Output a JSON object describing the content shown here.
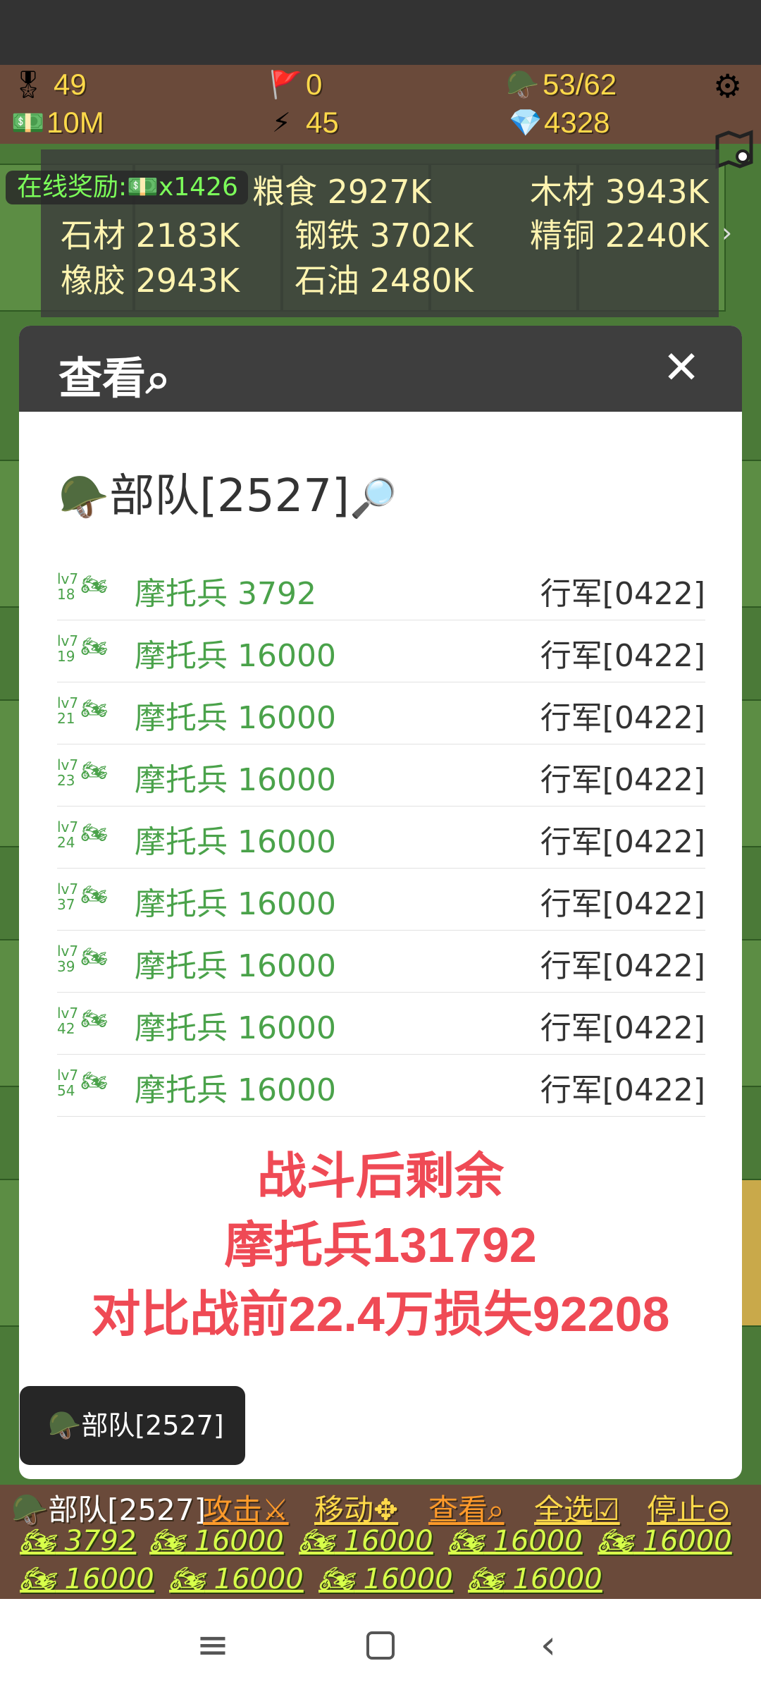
{
  "hud": {
    "medals": "49",
    "flags": "0",
    "troops": "53/62",
    "money": "10M",
    "energy": "45",
    "gems": "4328"
  },
  "reward": {
    "label": "在线奖励:💵x1426"
  },
  "resources": [
    {
      "label": "粮食 2927K"
    },
    {
      "label": "木材 3943K"
    },
    {
      "label": "石材 2183K"
    },
    {
      "label": "钢铁 3702K"
    },
    {
      "label": "精铜 2240K"
    },
    {
      "label": "橡胶 2943K"
    },
    {
      "label": "石油 2480K"
    }
  ],
  "modal": {
    "title": "查看⌕",
    "close": "✕",
    "troop_title": "部队[2527]",
    "units": [
      {
        "lvl_top": "lv7",
        "lvl_bottom": "18",
        "name": "摩托兵 3792",
        "status": "行军[0422]"
      },
      {
        "lvl_top": "lv7",
        "lvl_bottom": "19",
        "name": "摩托兵 16000",
        "status": "行军[0422]"
      },
      {
        "lvl_top": "lv7",
        "lvl_bottom": "21",
        "name": "摩托兵 16000",
        "status": "行军[0422]"
      },
      {
        "lvl_top": "lv7",
        "lvl_bottom": "23",
        "name": "摩托兵 16000",
        "status": "行军[0422]"
      },
      {
        "lvl_top": "lv7",
        "lvl_bottom": "24",
        "name": "摩托兵 16000",
        "status": "行军[0422]"
      },
      {
        "lvl_top": "lv7",
        "lvl_bottom": "37",
        "name": "摩托兵 16000",
        "status": "行军[0422]"
      },
      {
        "lvl_top": "lv7",
        "lvl_bottom": "39",
        "name": "摩托兵 16000",
        "status": "行军[0422]"
      },
      {
        "lvl_top": "lv7",
        "lvl_bottom": "42",
        "name": "摩托兵 16000",
        "status": "行军[0422]"
      },
      {
        "lvl_top": "lv7",
        "lvl_bottom": "54",
        "name": "摩托兵 16000",
        "status": "行军[0422]"
      }
    ],
    "note_lines": [
      "战斗后剩余",
      "摩托兵131792",
      "对比战前22.4万损失92208"
    ]
  },
  "toast": {
    "label": "部队[2527]"
  },
  "action_bar": {
    "troop_label": "部队[2527]",
    "attack": "攻击⚔",
    "move": "移动✥",
    "view": "查看⌕",
    "select_all": "全选☑",
    "stop": "停止⊝",
    "chips": [
      "3792",
      "16000",
      "16000",
      "16000",
      "16000",
      "16000",
      "16000",
      "16000",
      "16000"
    ]
  },
  "icons": {
    "medal": "medal-icon",
    "flag": "flag-icon",
    "helmet": "helmet-icon",
    "money": "money-icon",
    "lightning": "lightning-icon",
    "gem": "gem-icon",
    "gear": "gear-icon",
    "map": "map-icon",
    "magnifier": "magnifier-icon",
    "motorcycle": "motorcycle-icon"
  },
  "colors": {
    "accent_green": "#4aa24a",
    "note_red": "#ef4a55",
    "hud_yellow": "#ffd94a",
    "chip_yellow": "#d8ff4a"
  }
}
